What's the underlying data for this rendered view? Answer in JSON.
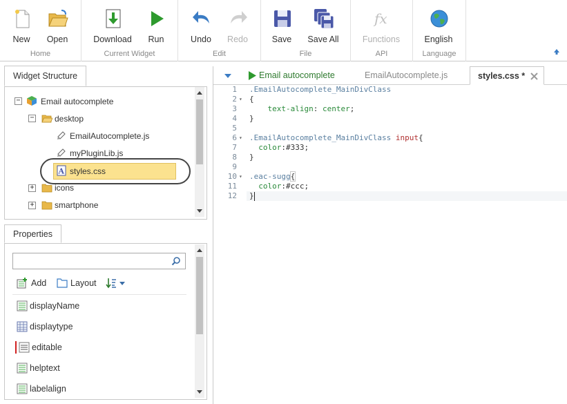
{
  "ribbon": {
    "groups": [
      {
        "label": "Home",
        "buttons": [
          {
            "label": "New",
            "icon": "new-document-icon"
          },
          {
            "label": "Open",
            "icon": "open-folder-icon"
          }
        ]
      },
      {
        "label": "Current Widget",
        "buttons": [
          {
            "label": "Download",
            "icon": "download-icon"
          },
          {
            "label": "Run",
            "icon": "run-icon"
          }
        ]
      },
      {
        "label": "Edit",
        "buttons": [
          {
            "label": "Undo",
            "icon": "undo-icon"
          },
          {
            "label": "Redo",
            "icon": "redo-icon",
            "disabled": true
          }
        ]
      },
      {
        "label": "File",
        "buttons": [
          {
            "label": "Save",
            "icon": "save-icon"
          },
          {
            "label": "Save All",
            "icon": "save-all-icon"
          }
        ]
      },
      {
        "label": "API",
        "buttons": [
          {
            "label": "Functions",
            "icon": "functions-icon",
            "disabled": true
          }
        ]
      },
      {
        "label": "Language",
        "buttons": [
          {
            "label": "English",
            "icon": "globe-icon"
          }
        ]
      }
    ]
  },
  "widget_structure": {
    "tab_label": "Widget Structure",
    "tree": {
      "root": "Email autocomplete",
      "desktop": "desktop",
      "files": [
        "EmailAutocomplete.js",
        "myPluginLib.js",
        "styles.css"
      ],
      "icons": "icons",
      "smartphone": "smartphone"
    }
  },
  "properties": {
    "tab_label": "Properties",
    "search_placeholder": "",
    "toolbar": {
      "add": "Add",
      "layout": "Layout"
    },
    "items": [
      "displayName",
      "displaytype",
      "editable",
      "helptext",
      "labelalign"
    ]
  },
  "editor": {
    "tabs": [
      {
        "label": "Email autocomplete"
      },
      {
        "label": "EmailAutocomplete.js"
      },
      {
        "label": "styles.css *"
      }
    ],
    "lines": [
      {
        "n": "1",
        "fold": "",
        "parts": [
          {
            "t": ".EmailAutocomplete_MainDivClass",
            "c": "sel"
          }
        ]
      },
      {
        "n": "2",
        "fold": "▾",
        "parts": [
          {
            "t": "{",
            "c": "val"
          }
        ]
      },
      {
        "n": "3",
        "fold": "",
        "parts": [
          {
            "t": "    text-align",
            "c": "prop"
          },
          {
            "t": ": ",
            "c": "val"
          },
          {
            "t": "center",
            "c": "prop"
          },
          {
            "t": ";",
            "c": "val"
          }
        ]
      },
      {
        "n": "4",
        "fold": "",
        "parts": [
          {
            "t": "}",
            "c": "val"
          }
        ]
      },
      {
        "n": "5",
        "fold": "",
        "parts": []
      },
      {
        "n": "6",
        "fold": "▾",
        "parts": [
          {
            "t": ".EmailAutocomplete_MainDivClass ",
            "c": "sel"
          },
          {
            "t": "input",
            "c": "tag"
          },
          {
            "t": "{",
            "c": "val"
          }
        ]
      },
      {
        "n": "7",
        "fold": "",
        "parts": [
          {
            "t": "  color",
            "c": "prop"
          },
          {
            "t": ":#333;",
            "c": "val"
          }
        ]
      },
      {
        "n": "8",
        "fold": "",
        "parts": [
          {
            "t": "}",
            "c": "val"
          }
        ]
      },
      {
        "n": "9",
        "fold": "",
        "parts": []
      },
      {
        "n": "10",
        "fold": "▾",
        "parts": [
          {
            "t": ".eac-sugg",
            "c": "sel"
          },
          {
            "t": "{",
            "c": "val bracket-mark"
          }
        ]
      },
      {
        "n": "11",
        "fold": "",
        "parts": [
          {
            "t": "  color",
            "c": "prop"
          },
          {
            "t": ":#ccc;",
            "c": "val"
          }
        ]
      },
      {
        "n": "12",
        "fold": "",
        "parts": [
          {
            "t": "}",
            "c": "val"
          }
        ]
      }
    ]
  },
  "colors": {
    "accent": "#3b7cc4",
    "run_green": "#2e9a2e",
    "selection": "#fbe28f"
  }
}
